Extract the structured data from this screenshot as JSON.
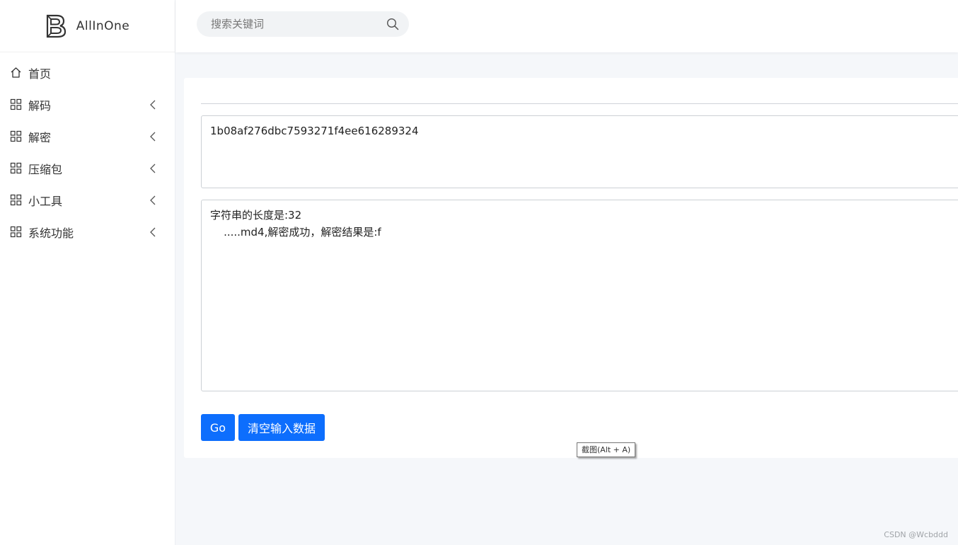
{
  "brand": {
    "name": "AllInOne",
    "logo_icon": "b-logo-icon"
  },
  "search": {
    "placeholder": "搜索关键词",
    "value": "",
    "icon": "search-icon"
  },
  "sidebar": {
    "items": [
      {
        "label": "首页",
        "icon": "home-icon",
        "has_submenu": false
      },
      {
        "label": "解码",
        "icon": "grid-icon",
        "has_submenu": true
      },
      {
        "label": "解密",
        "icon": "grid-icon",
        "has_submenu": true
      },
      {
        "label": "压缩包",
        "icon": "grid-icon",
        "has_submenu": true
      },
      {
        "label": "小工具",
        "icon": "grid-icon",
        "has_submenu": true
      },
      {
        "label": "系统功能",
        "icon": "grid-icon",
        "has_submenu": true
      }
    ]
  },
  "main": {
    "input_value": "1b08af276dbc7593271f4ee616289324",
    "output_line1": "字符串的长度是:32",
    "output_line2": "    .....md4,解密成功，解密结果是:f",
    "go_label": "Go",
    "clear_label": "清空输入数据"
  },
  "tooltip": {
    "text": "截图(Alt + A)"
  },
  "watermark": "CSDN @Wcbddd",
  "colors": {
    "primary": "#0d6efd",
    "background": "#f5f7fa",
    "sidebar": "#ffffff"
  }
}
